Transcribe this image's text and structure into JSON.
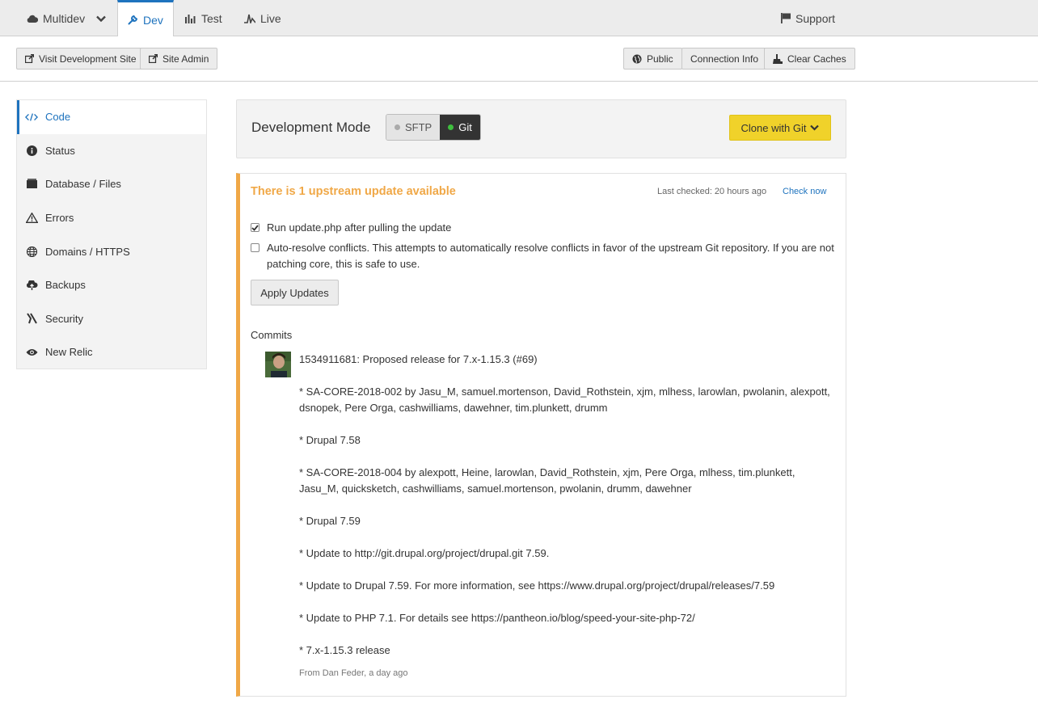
{
  "env_tabs": {
    "multidev": "Multidev",
    "dev": "Dev",
    "test": "Test",
    "live": "Live",
    "support": "Support"
  },
  "toolbar": {
    "visit_site": "Visit Development Site",
    "site_admin": "Site Admin",
    "public": "Public",
    "connection_info": "Connection Info",
    "clear_caches": "Clear Caches"
  },
  "sidebar": {
    "items": [
      {
        "label": "Code",
        "icon": "code-icon",
        "active": true
      },
      {
        "label": "Status",
        "icon": "info-icon"
      },
      {
        "label": "Database / Files",
        "icon": "database-icon"
      },
      {
        "label": "Errors",
        "icon": "warning-icon"
      },
      {
        "label": "Domains / HTTPS",
        "icon": "globe-icon"
      },
      {
        "label": "Backups",
        "icon": "cloud-upload-icon"
      },
      {
        "label": "Security",
        "icon": "security-icon"
      },
      {
        "label": "New Relic",
        "icon": "eye-icon"
      }
    ]
  },
  "dev_mode": {
    "title": "Development Mode",
    "sftp": "SFTP",
    "git": "Git",
    "selected": "Git",
    "clone_button": "Clone with Git"
  },
  "upstream": {
    "title": "There is 1 upstream update available",
    "last_checked": "Last checked: 20 hours ago",
    "check_now": "Check now",
    "option_run_update": "Run update.php after pulling the update",
    "option_run_update_checked": true,
    "option_auto_resolve": "Auto-resolve conflicts. This attempts to automatically resolve conflicts in favor of the upstream Git repository. If you are not patching core, this is safe to use.",
    "option_auto_resolve_checked": false,
    "apply_button": "Apply Updates",
    "commits_heading": "Commits",
    "commit": {
      "lines": [
        "1534911681: Proposed release for 7.x-1.15.3 (#69)",
        "* SA-CORE-2018-002 by Jasu_M, samuel.mortenson, David_Rothstein, xjm, mlhess, larowlan, pwolanin, alexpott, dsnopek, Pere Orga, cashwilliams, dawehner, tim.plunkett, drumm",
        "* Drupal 7.58",
        "* SA-CORE-2018-004 by alexpott, Heine, larowlan, David_Rothstein, xjm, Pere Orga, mlhess, tim.plunkett, Jasu_M, quicksketch, cashwilliams, samuel.mortenson, pwolanin, drumm, dawehner",
        "* Drupal 7.59",
        "* Update to http://git.drupal.org/project/drupal.git 7.59.",
        "* Update to Drupal 7.59. For more information, see https://www.drupal.org/project/drupal/releases/7.59",
        "* Update to PHP 7.1. For details see https://pantheon.io/blog/speed-your-site-php-72/",
        "* 7.x-1.15.3 release"
      ],
      "from": "From Dan Feder, a day ago"
    }
  },
  "colors": {
    "accent_blue": "#1e73be",
    "warning_orange": "#f0a847",
    "clone_yellow": "#f0d22a",
    "git_green": "#3fbf3f"
  }
}
